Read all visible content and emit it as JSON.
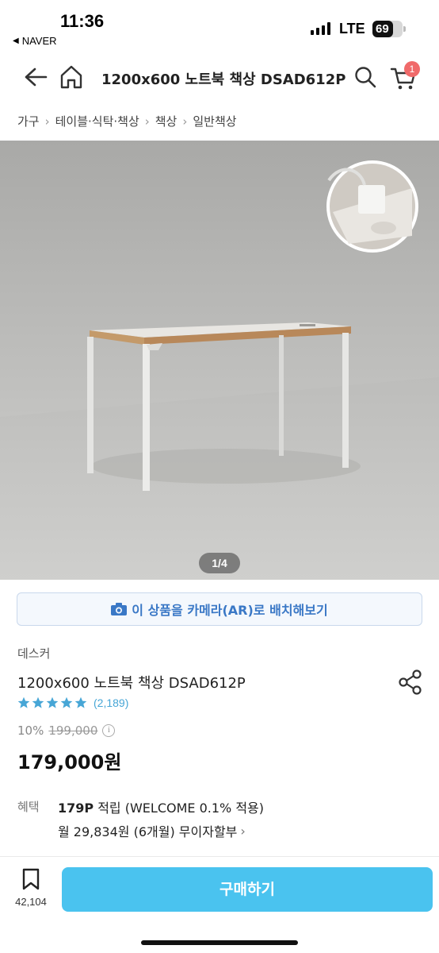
{
  "status_bar": {
    "time": "11:36",
    "back_app": "NAVER",
    "network": "LTE",
    "battery_level": "69",
    "battery_percent": 69
  },
  "nav": {
    "title": "1200x600 노트북 책상 DSAD612P",
    "cart_count": "1",
    "icons": [
      "back-arrow-icon",
      "home-icon",
      "search-icon",
      "cart-icon"
    ]
  },
  "breadcrumb": [
    "가구",
    "테이블·식탁·책상",
    "책상",
    "일반책상"
  ],
  "hero": {
    "page_indicator": "1/4",
    "current_page": 1,
    "total_pages": 4
  },
  "ar_button": {
    "label": "이 상품을 카메라(AR)로 배치해보기"
  },
  "product": {
    "brand": "데스커",
    "name": "1200x600 노트북 책상 DSAD612P",
    "rating_stars": 5,
    "review_count": "(2,189)",
    "discount_rate": "10%",
    "original_price": "199,000",
    "sale_price": "179,000원"
  },
  "benefits": {
    "label": "혜택",
    "points_bold": "179P",
    "points_rest": " 적립 (WELCOME 0.1% 적용)",
    "installment": "월 29,834원 (6개월) 무이자할부"
  },
  "bottom_bar": {
    "bookmark_count": "42,104",
    "buy_label": "구매하기"
  },
  "colors": {
    "accent": "#4ac3ef",
    "ar_text": "#3a78c6",
    "badge": "#f06a6a",
    "review_link": "#47a6d6"
  }
}
